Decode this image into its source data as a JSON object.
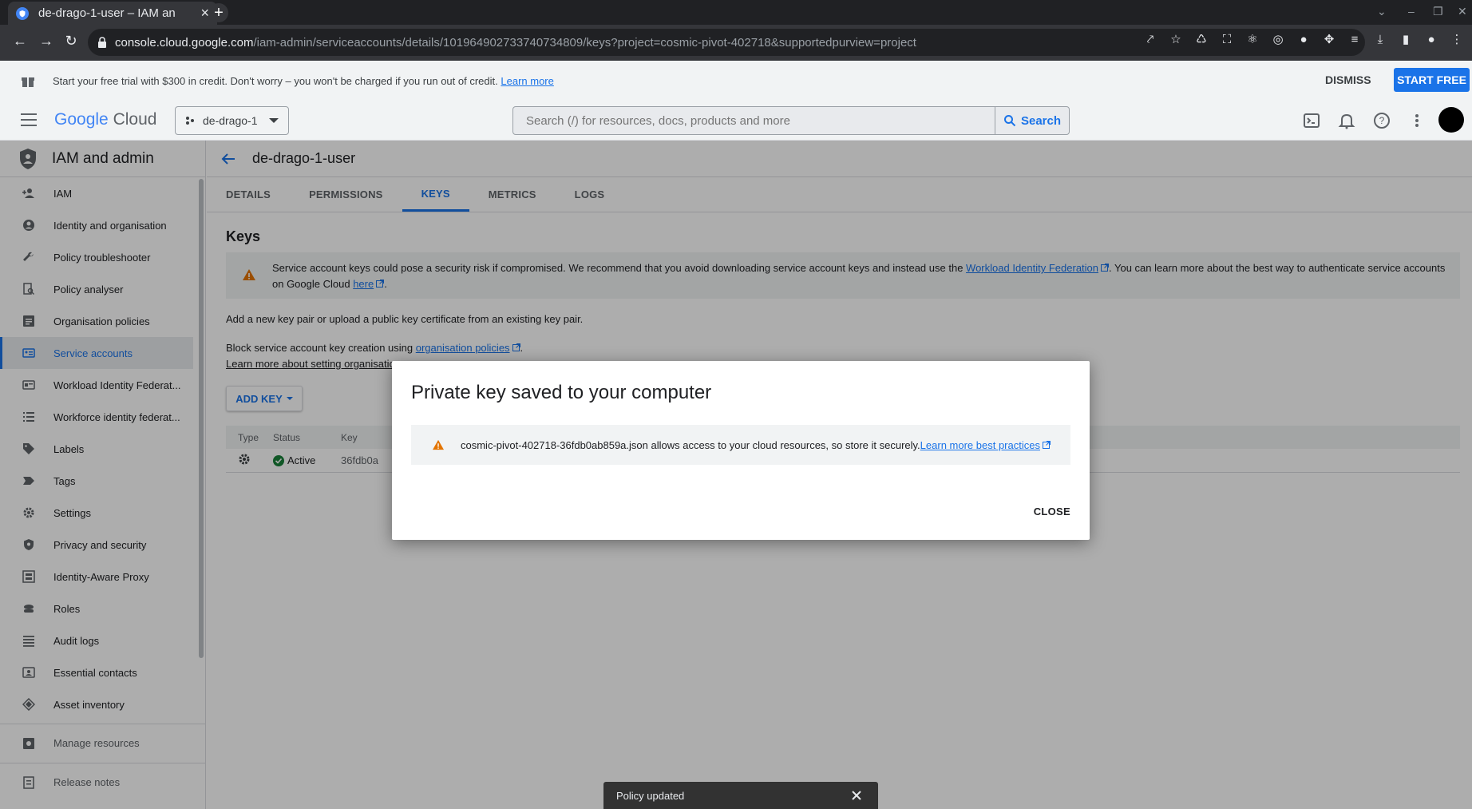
{
  "browser": {
    "tab_title": "de-drago-1-user – IAM an",
    "url_host": "console.cloud.google.com",
    "url_path": "/iam-admin/serviceaccounts/details/101964902733740734809/keys?project=cosmic-pivot-402718&supportedpurview=project"
  },
  "banner": {
    "text": "Start your free trial with $300 in credit. Don't worry – you won't be charged if you run out of credit.",
    "link": "Learn more",
    "dismiss": "DISMISS",
    "start": "START FREE"
  },
  "header": {
    "logo_google": "Google",
    "logo_cloud": "Cloud",
    "project": "de-drago-1",
    "search_placeholder": "Search (/) for resources, docs, products and more",
    "search_button": "Search"
  },
  "sidebar": {
    "title": "IAM and admin",
    "items": [
      {
        "label": "IAM",
        "icon": "person-add-icon"
      },
      {
        "label": "Identity and organisation",
        "icon": "account-circle-icon"
      },
      {
        "label": "Policy troubleshooter",
        "icon": "wrench-icon"
      },
      {
        "label": "Policy analyser",
        "icon": "document-search-icon"
      },
      {
        "label": "Organisation policies",
        "icon": "list-doc-icon"
      },
      {
        "label": "Service accounts",
        "icon": "service-account-icon"
      },
      {
        "label": "Workload Identity Federat...",
        "icon": "id-card-icon"
      },
      {
        "label": "Workforce identity federat...",
        "icon": "list-icon"
      },
      {
        "label": "Labels",
        "icon": "label-icon"
      },
      {
        "label": "Tags",
        "icon": "tag-icon"
      },
      {
        "label": "Settings",
        "icon": "gear-icon"
      },
      {
        "label": "Privacy and security",
        "icon": "shield-icon"
      },
      {
        "label": "Identity-Aware Proxy",
        "icon": "proxy-icon"
      },
      {
        "label": "Roles",
        "icon": "roles-icon"
      },
      {
        "label": "Audit logs",
        "icon": "audit-list-icon"
      },
      {
        "label": "Essential contacts",
        "icon": "contact-card-icon"
      },
      {
        "label": "Asset inventory",
        "icon": "diamond-icon"
      }
    ],
    "manage": "Manage resources",
    "release": "Release notes"
  },
  "main": {
    "title": "de-drago-1-user",
    "tabs": [
      "DETAILS",
      "PERMISSIONS",
      "KEYS",
      "METRICS",
      "LOGS"
    ],
    "active_tab": "KEYS",
    "section_title": "Keys",
    "warning_pre": "Service account keys could pose a security risk if compromised. We recommend that you avoid downloading service account keys and instead use the",
    "warning_link1": "Workload Identity Federation",
    "warning_mid": ". You can learn more about the best way to authenticate service accounts on Google Cloud",
    "warning_link2": "here",
    "warning_end": ".",
    "add_text": "Add a new key pair or upload a public key certificate from an existing key pair.",
    "block_pre": "Block service account key creation using",
    "block_link": "organisation policies",
    "learn_more": "Learn more about setting organisatio",
    "add_key": "ADD KEY",
    "table": {
      "headers": [
        "Type",
        "Status",
        "Key"
      ],
      "rows": [
        {
          "status": "Active",
          "key": "36fdb0a"
        }
      ]
    }
  },
  "dialog": {
    "title": "Private key saved to your computer",
    "message": "cosmic-pivot-402718-36fdb0ab859a.json allows access to your cloud resources, so store it securely.",
    "link": "Learn more best practices",
    "close": "CLOSE"
  },
  "snackbar": {
    "text": "Policy updated"
  }
}
